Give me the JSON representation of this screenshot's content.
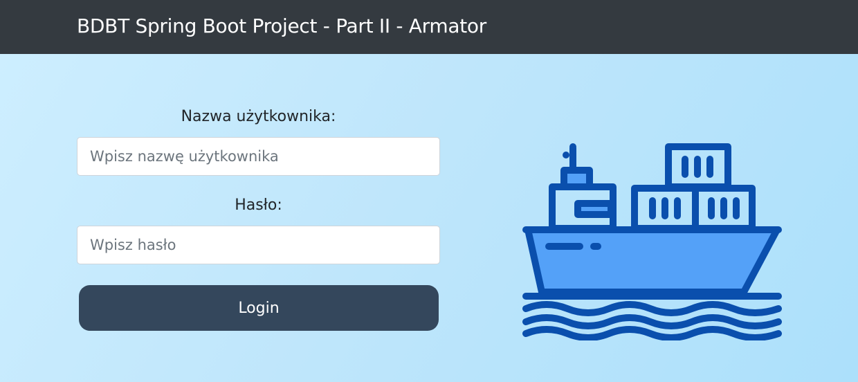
{
  "navbar": {
    "brand": "BDBT Spring Boot Project - Part II - Armator"
  },
  "login_form": {
    "username_label": "Nazwa użytkownika:",
    "username_placeholder": "Wpisz nazwę użytkownika",
    "username_value": "",
    "password_label": "Hasło:",
    "password_placeholder": "Wpisz hasło",
    "password_value": "",
    "login_button": "Login"
  },
  "illustration": {
    "icon": "cargo-ship-icon"
  },
  "colors": {
    "navbar": "#343a40",
    "button": "#34475c",
    "ship_outline": "#0a4fad",
    "ship_fill": "#54a1f8",
    "background": "#bfe6fb"
  }
}
